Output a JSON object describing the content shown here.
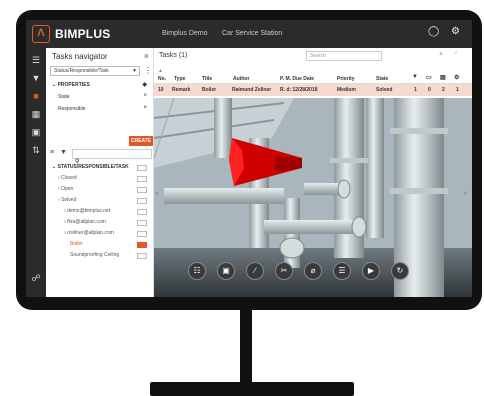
{
  "app": {
    "brand": "BIMPLUS",
    "logo_letter": "Λ",
    "project": "Bimplus Demo",
    "model": "Car Service Station",
    "accent": "#e2572b"
  },
  "topbar_icons": [
    "support-icon",
    "settings-icon"
  ],
  "rail_icons": [
    "hierarchy-icon",
    "filter-icon",
    "tasks-icon",
    "share-icon",
    "layers-icon",
    "compare-icon",
    "cart-icon"
  ],
  "navigator": {
    "title": "Tasks navigator",
    "grouping_value": "Status/Responsible/Task",
    "properties_label": "PROPERTIES",
    "property_rows": [
      "State",
      "Responsible"
    ],
    "create_label": "CREATE",
    "tree": [
      {
        "label": "STATUS/RESPONSIBLE/TASK",
        "badge": "",
        "level": 0,
        "bold": true,
        "active": false
      },
      {
        "label": "Closed",
        "badge": "",
        "level": 1,
        "bold": false,
        "active": false
      },
      {
        "label": "Open",
        "badge": "",
        "level": 1,
        "bold": false,
        "active": false
      },
      {
        "label": "Solved",
        "badge": "",
        "level": 1,
        "bold": false,
        "active": false
      },
      {
        "label": "demo@bimplus.net",
        "badge": "",
        "level": 2,
        "bold": false,
        "active": false
      },
      {
        "label": "fkra@allplan.com",
        "badge": "",
        "level": 2,
        "bold": false,
        "active": false
      },
      {
        "label": "rzellner@allplan.com",
        "badge": "",
        "level": 2,
        "bold": false,
        "active": false
      },
      {
        "label": "Boiler",
        "badge": "",
        "level": 3,
        "bold": false,
        "active": true
      },
      {
        "label": "Soundproofing Ceiling",
        "badge": "",
        "level": 3,
        "bold": false,
        "active": false
      }
    ]
  },
  "tasks": {
    "title": "Tasks (1)",
    "search_placeholder": "Search",
    "columns": [
      "No.",
      "Type",
      "Title",
      "Author",
      "P. M. Due Date",
      "Priority",
      "State"
    ],
    "icon_columns": [
      "attachment-icon",
      "comment-icon",
      "document-icon",
      "settings-icon"
    ],
    "row": {
      "no": "10",
      "type": "Remark",
      "title": "Boiler",
      "author": "Raimund Zellner",
      "pm_due": "R. d: 12/28/2018",
      "priority": "Medium",
      "state": "Solved",
      "n1": "1",
      "n2": "0",
      "n3": "2",
      "n4": "1"
    }
  },
  "viewport_tools": [
    "clipboard-icon",
    "zoom-icon",
    "measure-icon",
    "cut-icon",
    "hide-icon",
    "layers-icon",
    "camera-icon",
    "refresh-icon"
  ]
}
